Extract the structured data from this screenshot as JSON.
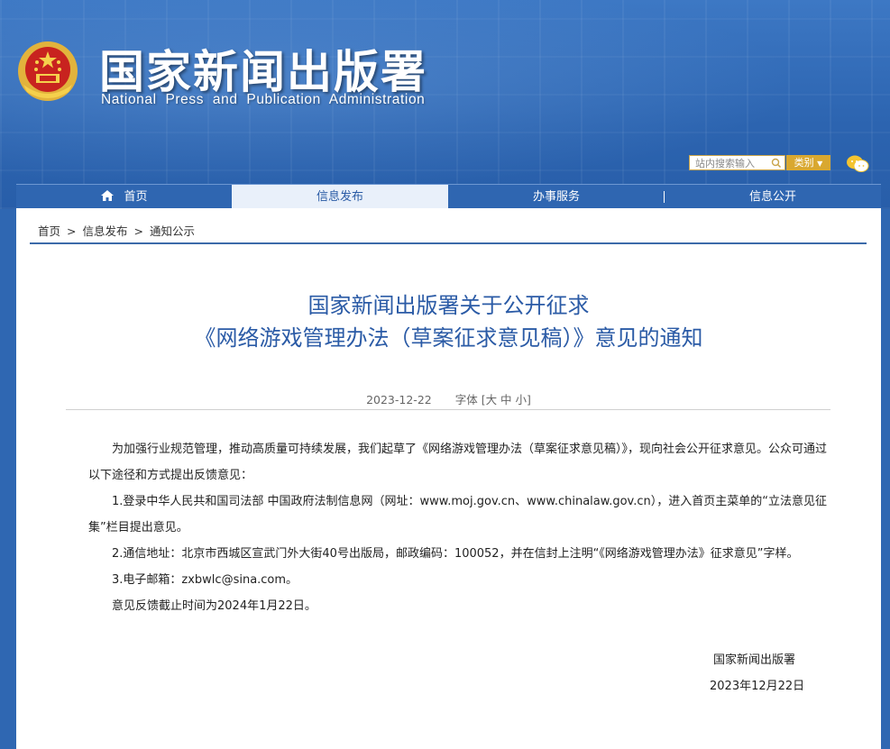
{
  "header": {
    "site_title": "国家新闻出版署",
    "site_subtitle": "National  Press  and  Publication  Administration",
    "search_placeholder": "站内搜索输入",
    "category_label": "类别"
  },
  "nav": {
    "items": [
      {
        "label": "首页"
      },
      {
        "label": "信息发布"
      },
      {
        "label": "办事服务"
      },
      {
        "label": "信息公开"
      }
    ]
  },
  "breadcrumb": [
    "首页",
    ">",
    "信息发布",
    ">",
    "通知公示"
  ],
  "article": {
    "title_line1": "国家新闻出版署关于公开征求",
    "title_line2": "《网络游戏管理办法（草案征求意见稿）》意见的通知",
    "date": "2023-12-22",
    "font_label": "字体",
    "font_sizes": "[大 中 小]",
    "paragraphs": [
      "　　为加强行业规范管理，推动高质量可持续发展，我们起草了《网络游戏管理办法（草案征求意见稿）》，现向社会公开征求意见。公众可通过以下途径和方式提出反馈意见：",
      "　　1.登录中华人民共和国司法部 中国政府法制信息网（网址：www.moj.gov.cn、www.chinalaw.gov.cn），进入首页主菜单的“立法意见征集”栏目提出意见。",
      "　　2.通信地址：北京市西城区宣武门外大街40号出版局，邮政编码：100052，并在信封上注明“《网络游戏管理办法》征求意见”字样。",
      "　　3.电子邮箱：zxbwlc@sina.com。",
      "　　意见反馈截止时间为2024年1月22日。"
    ],
    "signature_org": "国家新闻出版署",
    "signature_date": "2023年12月22日"
  },
  "colors": {
    "banner_blue": "#2f67b2",
    "title_blue": "#2b5ba6",
    "gold": "#d9a830"
  }
}
